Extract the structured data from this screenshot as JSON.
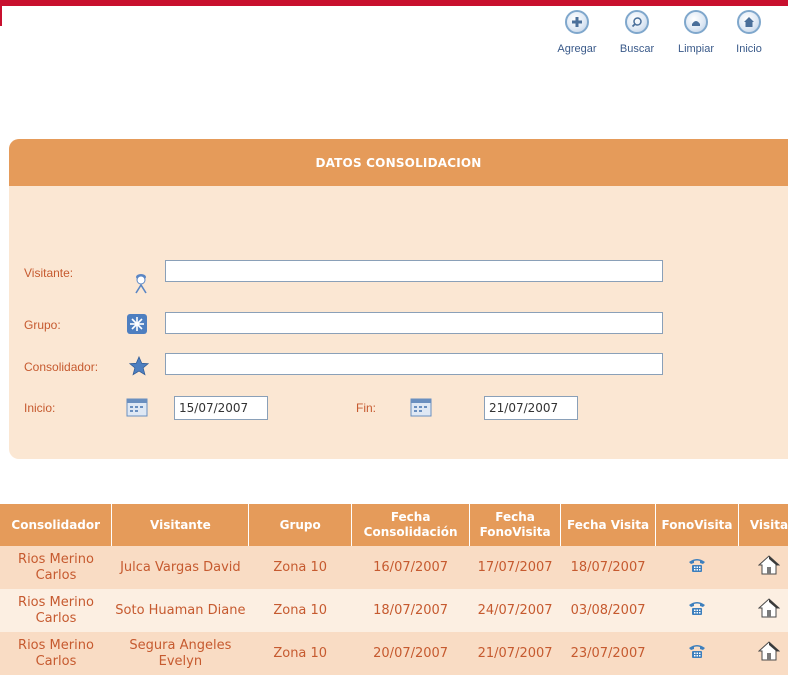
{
  "toolbar": {
    "items": [
      {
        "label": "Agregar",
        "icon": "add-icon"
      },
      {
        "label": "Buscar",
        "icon": "search-icon"
      },
      {
        "label": "Limpiar",
        "icon": "clean-icon"
      },
      {
        "label": "Inicio",
        "icon": "home-icon"
      }
    ]
  },
  "panel": {
    "title": "DATOS CONSOLIDACION",
    "fields": {
      "visitante": {
        "label": "Visitante:",
        "value": ""
      },
      "grupo": {
        "label": "Grupo:",
        "value": ""
      },
      "consolidador": {
        "label": "Consolidador:",
        "value": ""
      },
      "inicio": {
        "label": "Inicio:",
        "value": "15/07/2007"
      },
      "fin": {
        "label": "Fin:",
        "value": "21/07/2007"
      }
    }
  },
  "table": {
    "headers": [
      "Consolidador",
      "Visitante",
      "Grupo",
      "Fecha Consolidación",
      "Fecha FonoVisita",
      "Fecha Visita",
      "FonoVisita",
      "Visita"
    ],
    "rows": [
      {
        "consolidador": "Rios Merino Carlos",
        "visitante": "Julca Vargas David",
        "grupo": "Zona 10",
        "fecha_consolidacion": "16/07/2007",
        "fecha_fonovisita": "17/07/2007",
        "fecha_visita": "18/07/2007"
      },
      {
        "consolidador": "Rios Merino Carlos",
        "visitante": "Soto Huaman Diane",
        "grupo": "Zona 10",
        "fecha_consolidacion": "18/07/2007",
        "fecha_fonovisita": "24/07/2007",
        "fecha_visita": "03/08/2007"
      },
      {
        "consolidador": "Rios Merino Carlos",
        "visitante": "Segura Angeles Evelyn",
        "grupo": "Zona 10",
        "fecha_consolidacion": "20/07/2007",
        "fecha_fonovisita": "21/07/2007",
        "fecha_visita": "23/07/2007"
      }
    ],
    "row_icons": {
      "phone": "phone-icon",
      "visit": "house-icon"
    }
  },
  "colors": {
    "accent": "#e59b5a",
    "panel_bg": "#fbe7d3",
    "text": "#c65a2f",
    "top_bar": "#c8102e"
  }
}
